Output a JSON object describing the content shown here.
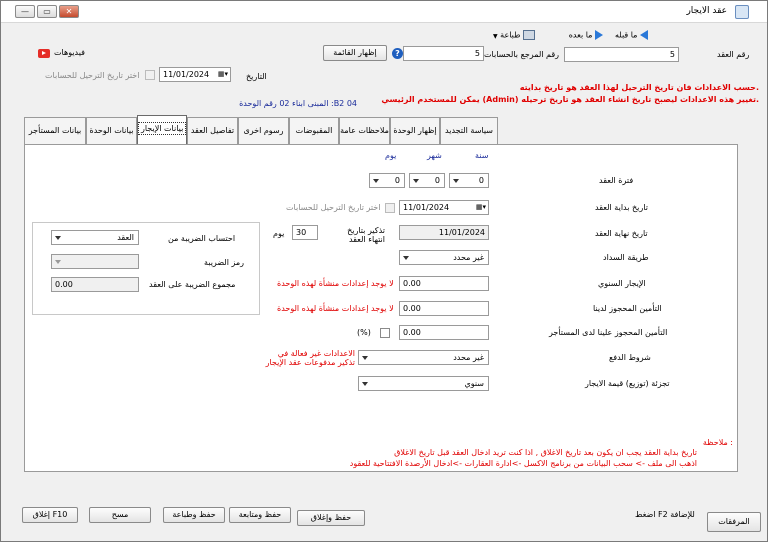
{
  "window": {
    "title": "عقد الايجار",
    "controls": {
      "close": "✕",
      "restore": "▭",
      "minimize": "—"
    }
  },
  "toolbar": {
    "print_label": "طباعة",
    "next_label": "ما بعده",
    "prev_label": "ما قبله",
    "dropdown_arrow": "▼"
  },
  "header": {
    "contract_no_label": "رقم العقد",
    "contract_no_value": "5",
    "accounts_ref_label": "رقم المرجع بالحسابات",
    "accounts_ref_value": "5",
    "show_list_button": "إظهار القائمة",
    "videos_label": "فيديوهات",
    "date_label": "التاريخ",
    "date_value": "11/01/2024",
    "choose_posting_date_label": "اختر تاريخ الترحيل للحسابات",
    "warning_line1": "حسب الاعدادات فان تاريخ الترحيل لهذا العقد هو تاريخ بدايته.",
    "warning_line2": "يمكن للمستخدم الرئيسي (Admin) تغيير هذه الاعدادات ليصبح تاريخ انشاء العقد هو تاريخ ترحيله.",
    "unit_info": "المبنى ابناء 02 رقم الوحدة  :B2 04"
  },
  "tabs": [
    {
      "label": "بيانات المستأجر"
    },
    {
      "label": "بيانات الوحدة"
    },
    {
      "label": "بيانات الإيجار"
    },
    {
      "label": "تفاصيل العقد"
    },
    {
      "label": "رسوم اخرى"
    },
    {
      "label": "المقبوضات"
    },
    {
      "label": "ملاحظات عامة"
    },
    {
      "label": "إظهار الوحدة"
    },
    {
      "label": "سياسة التجديد"
    }
  ],
  "rent": {
    "col_year": "سنة",
    "col_month": "شهر",
    "col_day": "يوم",
    "period_label": "فترة العقد",
    "period_year": "0",
    "period_month": "0",
    "period_day": "0",
    "start_date_label": "تاريخ بداية العقد",
    "start_date_value": "11/01/2024",
    "choose_posting_date_label": "اختر تاريخ الترحيل للحسابات",
    "end_date_label": "تاريخ نهاية العقد",
    "end_date_value": "11/01/2024",
    "reminder_label": "تذكير بتاريخ انتهاء العقد",
    "reminder_value": "30",
    "reminder_unit": "يوم",
    "payment_method_label": "طريقة السداد",
    "payment_method_value": "غير محدد",
    "annual_rent_label": "الإيجار السنوي",
    "annual_rent_value": "0.00",
    "no_settings_msg_1": "لا يوجد إعدادات منشأة لهذه الوحدة",
    "deposit_ours_label": "التأمين المحجوز لدينا",
    "deposit_ours_value": "0.00",
    "no_settings_msg_2": "لا يوجد إعدادات منشأة لهذه الوحدة",
    "deposit_tenant_label": "التأمين المحجوز علينا لدى المستأجر",
    "deposit_tenant_value": "0.00",
    "percent_label": "(%)",
    "payment_terms_label": "شروط الدفع",
    "payment_terms_value": "غير محدد",
    "reminder_settings_msg": "الاعدادات غير فعالة في تذكير مدفوعات عقد الإيجار",
    "rent_split_label": "تجزئة (توزيع) قيمة الايجار",
    "rent_split_value": "سنوي"
  },
  "tax": {
    "calc_tax_label": "احتساب الضريبة من",
    "calc_tax_value": "العقد",
    "tax_code_label": "رمز الضريبة",
    "tax_code_value": "",
    "tax_total_label": "مجموع الضريبة على العقد",
    "tax_total_value": "0.00"
  },
  "notes": {
    "title": "ملاحظة :",
    "line1": "تاريخ بداية العقد يجب ان يكون بعد تاريخ الاغلاق , اذا كنت تريد ادخال العقد قبل تاريخ الاغلاق",
    "line2": "اذهب الى ملف -> سحب البيانات من برنامج الاكسل ->ادارة العقارات ->ادخال الأرصدة الافتتاحية للعقود"
  },
  "footer": {
    "attachments": "المرفقات",
    "f2_hint": "اضغط F2 للإضافة",
    "save_close": "حفظ وإغلاق",
    "save_continue": "حفظ ومتابعة",
    "save_print": "حفظ وطباعة",
    "clear": "مسح",
    "close_f10": "إغلاق F10"
  },
  "colors": {
    "warning": "#e00000",
    "link_blue": "#1a2b9a",
    "youtube": "#e52d27"
  }
}
